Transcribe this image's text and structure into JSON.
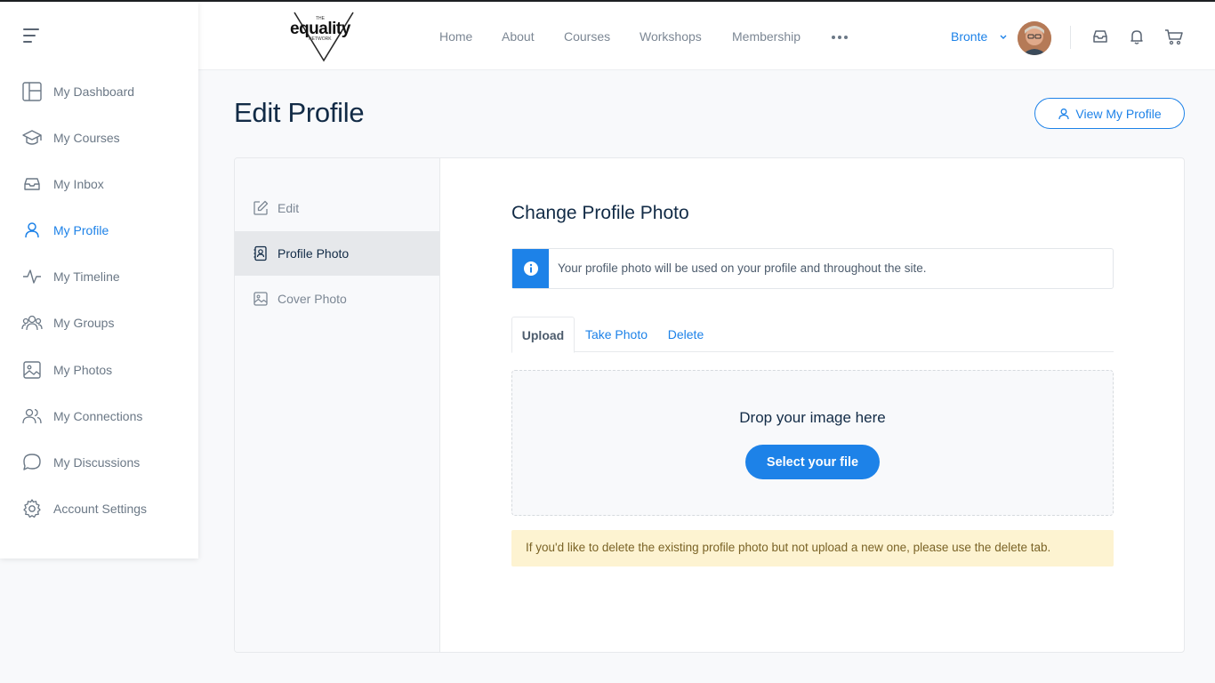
{
  "header": {
    "logo": {
      "top_word": "THE",
      "main_word": "equality",
      "bottom_word": "NETWORK"
    },
    "nav": [
      "Home",
      "About",
      "Courses",
      "Workshops",
      "Membership"
    ],
    "more_icon": "ellipsis-icon",
    "user": {
      "name": "Bronte",
      "avatar": "user-avatar"
    },
    "icons": [
      "inbox-icon",
      "bell-icon",
      "cart-icon"
    ]
  },
  "sidebar": {
    "menu_icon": "hamburger-icon",
    "items": [
      {
        "label": "My Dashboard",
        "icon": "dashboard-icon",
        "active": false
      },
      {
        "label": "My Courses",
        "icon": "graduation-cap-icon",
        "active": false
      },
      {
        "label": "My Inbox",
        "icon": "inbox-icon",
        "active": false
      },
      {
        "label": "My Profile",
        "icon": "user-icon",
        "active": true
      },
      {
        "label": "My Timeline",
        "icon": "activity-icon",
        "active": false
      },
      {
        "label": "My Groups",
        "icon": "groups-icon",
        "active": false
      },
      {
        "label": "My Photos",
        "icon": "image-icon",
        "active": false
      },
      {
        "label": "My Connections",
        "icon": "connections-icon",
        "active": false
      },
      {
        "label": "My Discussions",
        "icon": "chat-icon",
        "active": false
      },
      {
        "label": "Account Settings",
        "icon": "gear-icon",
        "active": false
      }
    ]
  },
  "page": {
    "title": "Edit Profile",
    "view_profile_label": "View My Profile"
  },
  "subnav": {
    "items": [
      {
        "label": "Edit",
        "icon": "edit-icon",
        "active": false
      },
      {
        "label": "Profile Photo",
        "icon": "profile-photo-icon",
        "active": true
      },
      {
        "label": "Cover Photo",
        "icon": "cover-photo-icon",
        "active": false
      }
    ]
  },
  "main": {
    "section_title": "Change Profile Photo",
    "info_text": "Your profile photo will be used on your profile and throughout the site.",
    "tabs": [
      {
        "label": "Upload",
        "active": true
      },
      {
        "label": "Take Photo",
        "active": false
      },
      {
        "label": "Delete",
        "active": false
      }
    ],
    "drop_text": "Drop your image here",
    "select_button": "Select your file",
    "warning_text": "If you'd like to delete the existing profile photo but not upload a new one, please use the delete tab."
  },
  "colors": {
    "accent": "#1d82e8",
    "heading": "#122b46",
    "muted": "#7c8794",
    "warning_bg": "#fdf3d1"
  }
}
